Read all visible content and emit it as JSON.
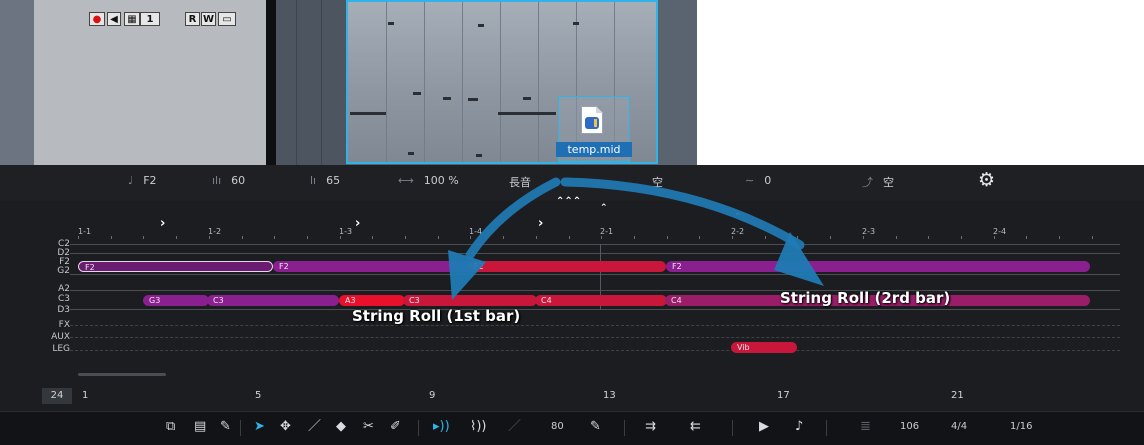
{
  "track": {
    "buttons": [
      "●",
      "◀",
      "▦",
      "1",
      "R",
      "W",
      "▭"
    ]
  },
  "file": {
    "name": "temp.mid",
    "icon": "midi-file-icon"
  },
  "params": {
    "pitch": "F2",
    "velocity": "60",
    "velocity2": "65",
    "length_pct": "100 %",
    "articulation": "長音",
    "slot1": "空",
    "value": "0",
    "slot2": "空"
  },
  "ruler": [
    "1-1",
    "1-2",
    "1-3",
    "1-4",
    "2-1",
    "2-2",
    "2-3",
    "2-4"
  ],
  "rows": [
    "C2",
    "D2",
    "F2",
    "G2",
    "A2",
    "C3",
    "D3",
    "FX",
    "AUX",
    "LEG"
  ],
  "notes": [
    "F2",
    "F2",
    "F2",
    "F2",
    "G3",
    "C3",
    "A3",
    "C3",
    "C4",
    "C4"
  ],
  "leg_note": "Vib",
  "annotations": {
    "first": "String Roll (1st bar)",
    "second": "String Roll (2rd bar)"
  },
  "measures": {
    "zoom": "24",
    "marks": [
      "1",
      "5",
      "9",
      "13",
      "17",
      "21"
    ]
  },
  "toolbar": {
    "velocity": "80",
    "tempo": "106",
    "meter": "4/4",
    "grid": "1/16"
  },
  "colors": {
    "accent": "#2fb4ea",
    "purple": "#8a1f8f",
    "crimson": "#c8173a",
    "red": "#e8102a"
  }
}
